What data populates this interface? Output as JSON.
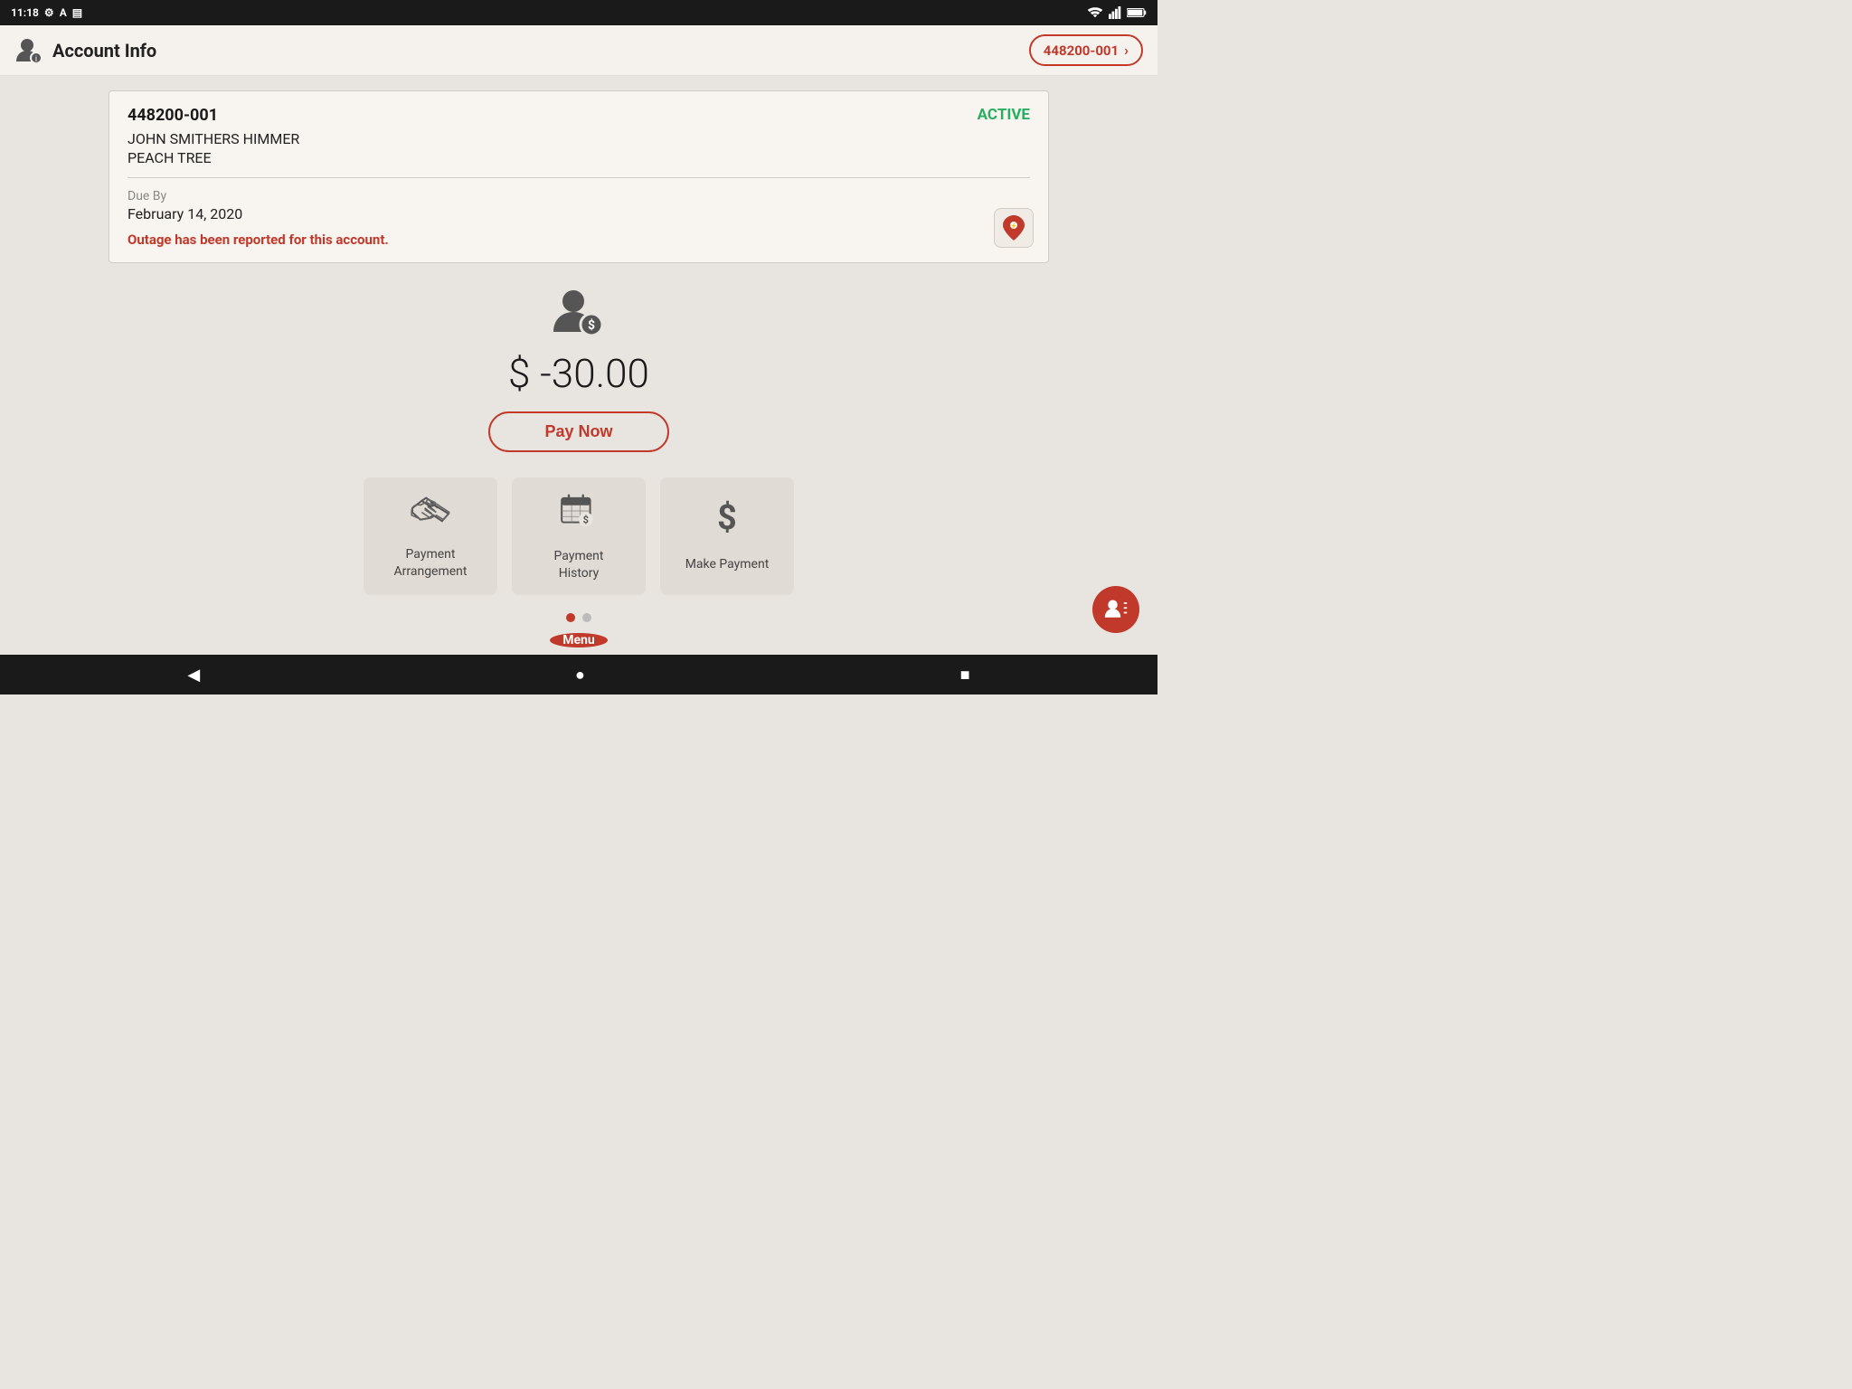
{
  "statusBar": {
    "time": "11:18",
    "icons": [
      "settings",
      "accessibility",
      "sim"
    ]
  },
  "appBar": {
    "title": "Account Info",
    "accountChip": "448200-001"
  },
  "accountCard": {
    "accountNumber": "448200-001",
    "status": "ACTIVE",
    "name": "JOHN SMITHERS HIMMER",
    "location": "PEACH TREE",
    "dueLabel": "Due By",
    "dueDate": "February 14, 2020",
    "outageMessage": "Outage has been reported for this account."
  },
  "balance": {
    "amount": "$ -30.00",
    "payNowLabel": "Pay Now"
  },
  "actions": [
    {
      "id": "payment-arrangement",
      "label": "Payment\nArrangement",
      "icon": "handshake"
    },
    {
      "id": "payment-history",
      "label": "Payment\nHistory",
      "icon": "calendar-dollar"
    },
    {
      "id": "make-payment",
      "label": "Make Payment",
      "icon": "dollar"
    }
  ],
  "menu": {
    "label": "Menu"
  },
  "dots": [
    {
      "active": true
    },
    {
      "active": false
    }
  ],
  "navBar": {
    "back": "◀",
    "home": "●",
    "recent": "■"
  }
}
